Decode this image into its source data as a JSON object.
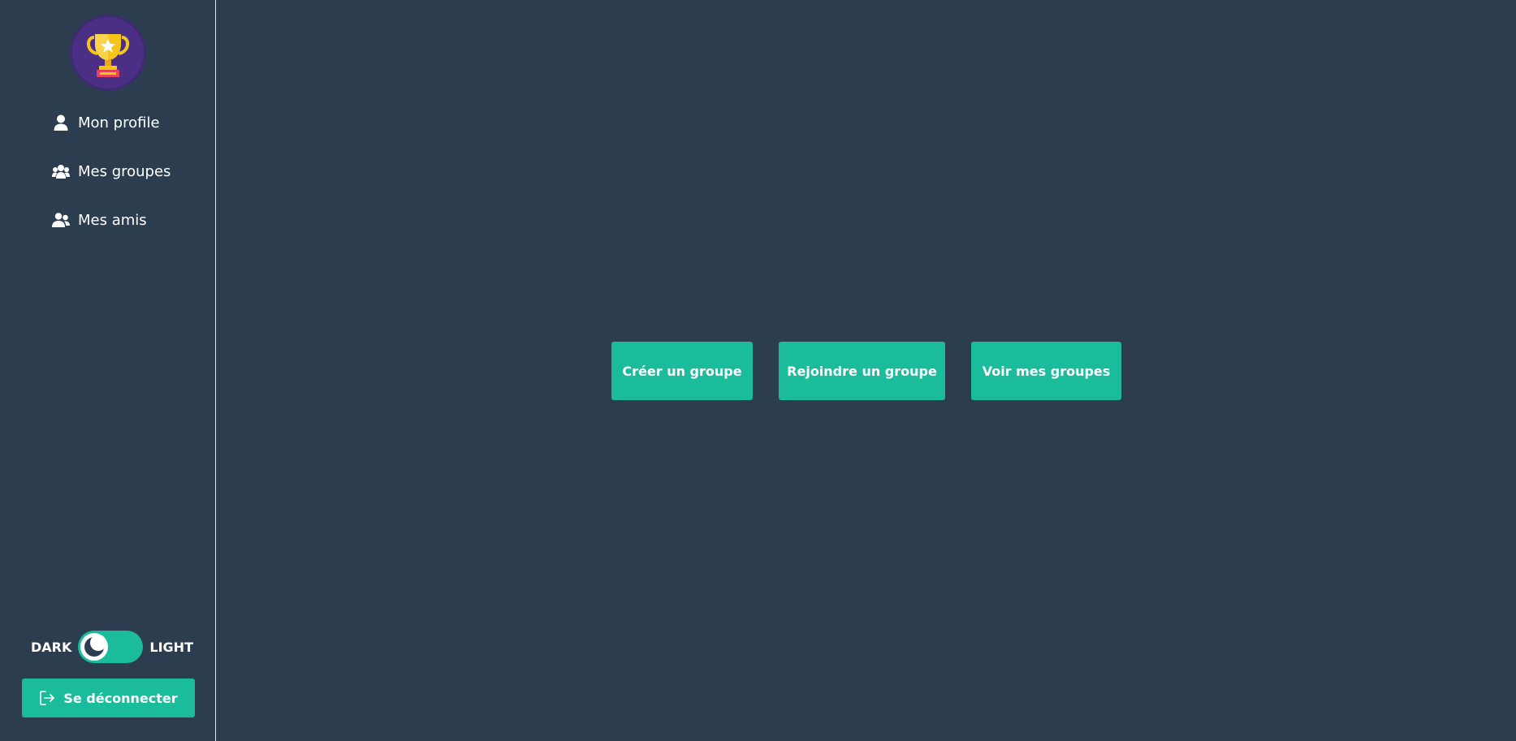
{
  "sidebar": {
    "logo": {
      "icon": "trophy-icon"
    },
    "items": [
      {
        "label": "Mon profile",
        "icon": "user-icon"
      },
      {
        "label": "Mes groupes",
        "icon": "users-group-icon"
      },
      {
        "label": "Mes amis",
        "icon": "user-friends-icon"
      }
    ],
    "theme": {
      "dark_label": "DARK",
      "light_label": "LIGHT",
      "current": "dark",
      "icon": "moon-icon"
    },
    "logout": {
      "label": "Se déconnecter",
      "icon": "sign-out-icon"
    }
  },
  "main": {
    "actions": [
      {
        "label": "Créer un groupe"
      },
      {
        "label": "Rejoindre un groupe"
      },
      {
        "label": "Voir mes groupes"
      }
    ]
  },
  "colors": {
    "background": "#2c3d50",
    "accent": "#1abc9c",
    "text": "#ffffff",
    "logo_bg": "#4a2f85",
    "trophy": "#f5c51a"
  }
}
